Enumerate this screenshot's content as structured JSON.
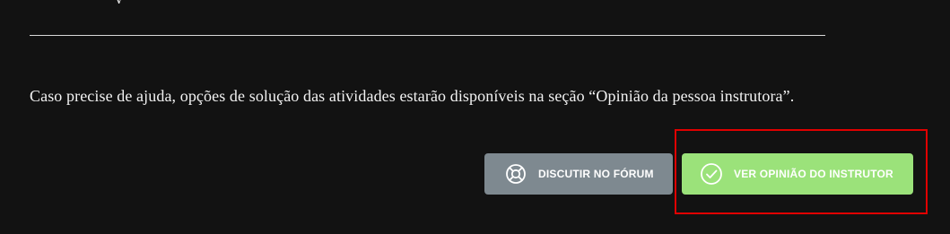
{
  "top_fragment": "y",
  "help_text": "Caso precise de ajuda, opções de solução das atividades estarão disponíveis na seção “Opinião da pessoa instrutora”.",
  "buttons": {
    "forum_label": "DISCUTIR NO FÓRUM",
    "forum_icon": "lifebuoy-icon",
    "instructor_label": "VER OPINIÃO DO INSTRUTOR",
    "instructor_icon": "check-circle-icon"
  },
  "colors": {
    "background": "#121212",
    "forum_button": "#7e8990",
    "instructor_button": "#9be27a",
    "highlight_border": "#e00000"
  }
}
